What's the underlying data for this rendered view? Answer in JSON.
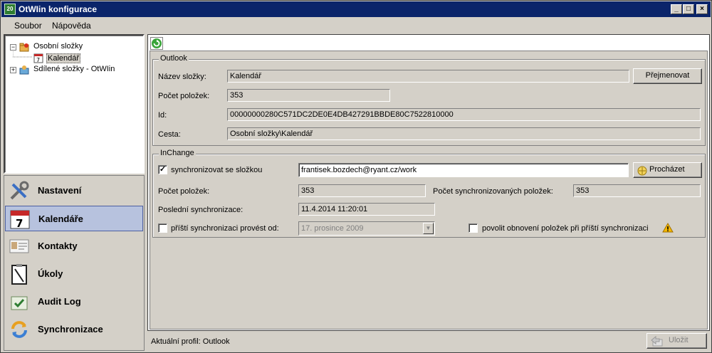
{
  "window": {
    "title": "OtWIin konfigurace",
    "app_icon_text": "20",
    "minimize": "_",
    "maximize": "□",
    "close": "×"
  },
  "menu": {
    "items": [
      "Soubor",
      "Nápověda"
    ]
  },
  "tree": {
    "items": [
      {
        "label": "Osobní složky",
        "toggle": "−"
      },
      {
        "label": "Kalendář"
      },
      {
        "label": "Sdílené složky - OtWIin",
        "toggle": "+"
      }
    ]
  },
  "nav": {
    "items": [
      {
        "label": "Nastavení",
        "icon": "tools-icon"
      },
      {
        "label": "Kalendáře",
        "icon": "calendar-icon"
      },
      {
        "label": "Kontakty",
        "icon": "contact-card-icon"
      },
      {
        "label": "Úkoly",
        "icon": "clipboard-icon"
      },
      {
        "label": "Audit Log",
        "icon": "audit-log-icon"
      },
      {
        "label": "Synchronizace",
        "icon": "sync-icon"
      }
    ],
    "active_index": 1
  },
  "outlook": {
    "legend": "Outlook",
    "folder_name_label": "Název složky:",
    "folder_name_value": "Kalendář",
    "rename_button": "Přejmenovat",
    "item_count_label": "Počet položek:",
    "item_count_value": "353",
    "id_label": "Id:",
    "id_value": "00000000280C571DC2DE0E4DB427291BBDE80C7522810000",
    "path_label": "Cesta:",
    "path_value": "Osobní složky\\Kalendář"
  },
  "inchange": {
    "legend": "InChange",
    "sync_checkbox_label": "synchronizovat se složkou",
    "sync_checked": "✓",
    "sync_folder_value": "frantisek.bozdech@ryant.cz/work",
    "browse_button": "Procházet",
    "item_count_label": "Počet položek:",
    "item_count_value": "353",
    "synced_count_label": "Počet synchronizovaných položek:",
    "synced_count_value": "353",
    "last_sync_label": "Poslední synchronizace:",
    "last_sync_value": "11.4.2014 11:20:01",
    "next_sync_label": "příští synchronizaci provést od:",
    "next_sync_value": "17. prosince  2009",
    "allow_restore_label": "povolit obnovení položek při příští synchronizaci"
  },
  "status": {
    "profile_label": "Aktuální profil: Outlook",
    "save_button": "Uložit"
  },
  "colors": {
    "titlebar": "#0a246a",
    "active_nav": "#b7c2de",
    "face": "#d4d0c8"
  }
}
